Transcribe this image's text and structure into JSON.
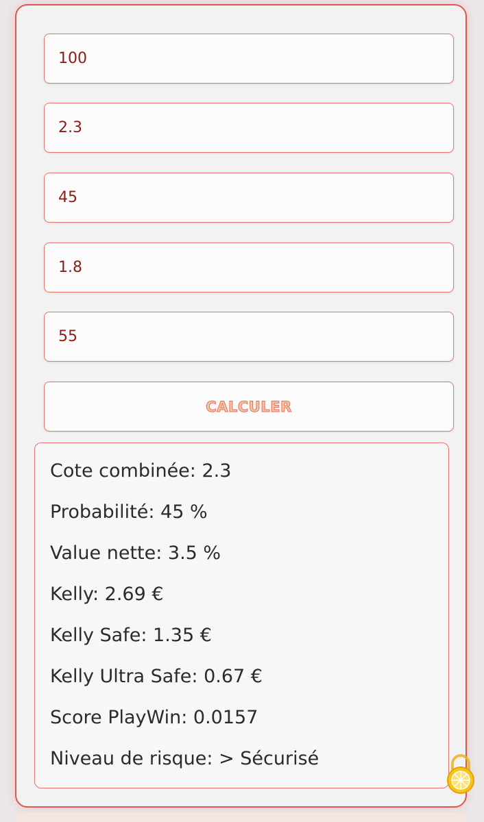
{
  "form": {
    "fields": [
      {
        "value": "100"
      },
      {
        "value": "2.3"
      },
      {
        "value": "45"
      },
      {
        "value": "1.8"
      },
      {
        "value": "55"
      }
    ],
    "calculate_label": "CALCULER"
  },
  "results": {
    "lines": [
      "Cote combinée: 2.3",
      "Probabilité: 45 %",
      "Value nette: 3.5 %",
      "Kelly: 2.69 €",
      "Kelly Safe: 1.35 €",
      "Kelly Ultra Safe: 0.67 €",
      "Score PlayWin: 0.0157",
      "Niveau de risque: > Sécurisé"
    ]
  },
  "icons": {
    "lock": "lock-icon"
  },
  "colors": {
    "accent": "#e0554f",
    "input_text": "#8a1d14",
    "button_text": "#f6c6a2",
    "result_text": "#2b2b2b",
    "lock": "#f5c518"
  }
}
